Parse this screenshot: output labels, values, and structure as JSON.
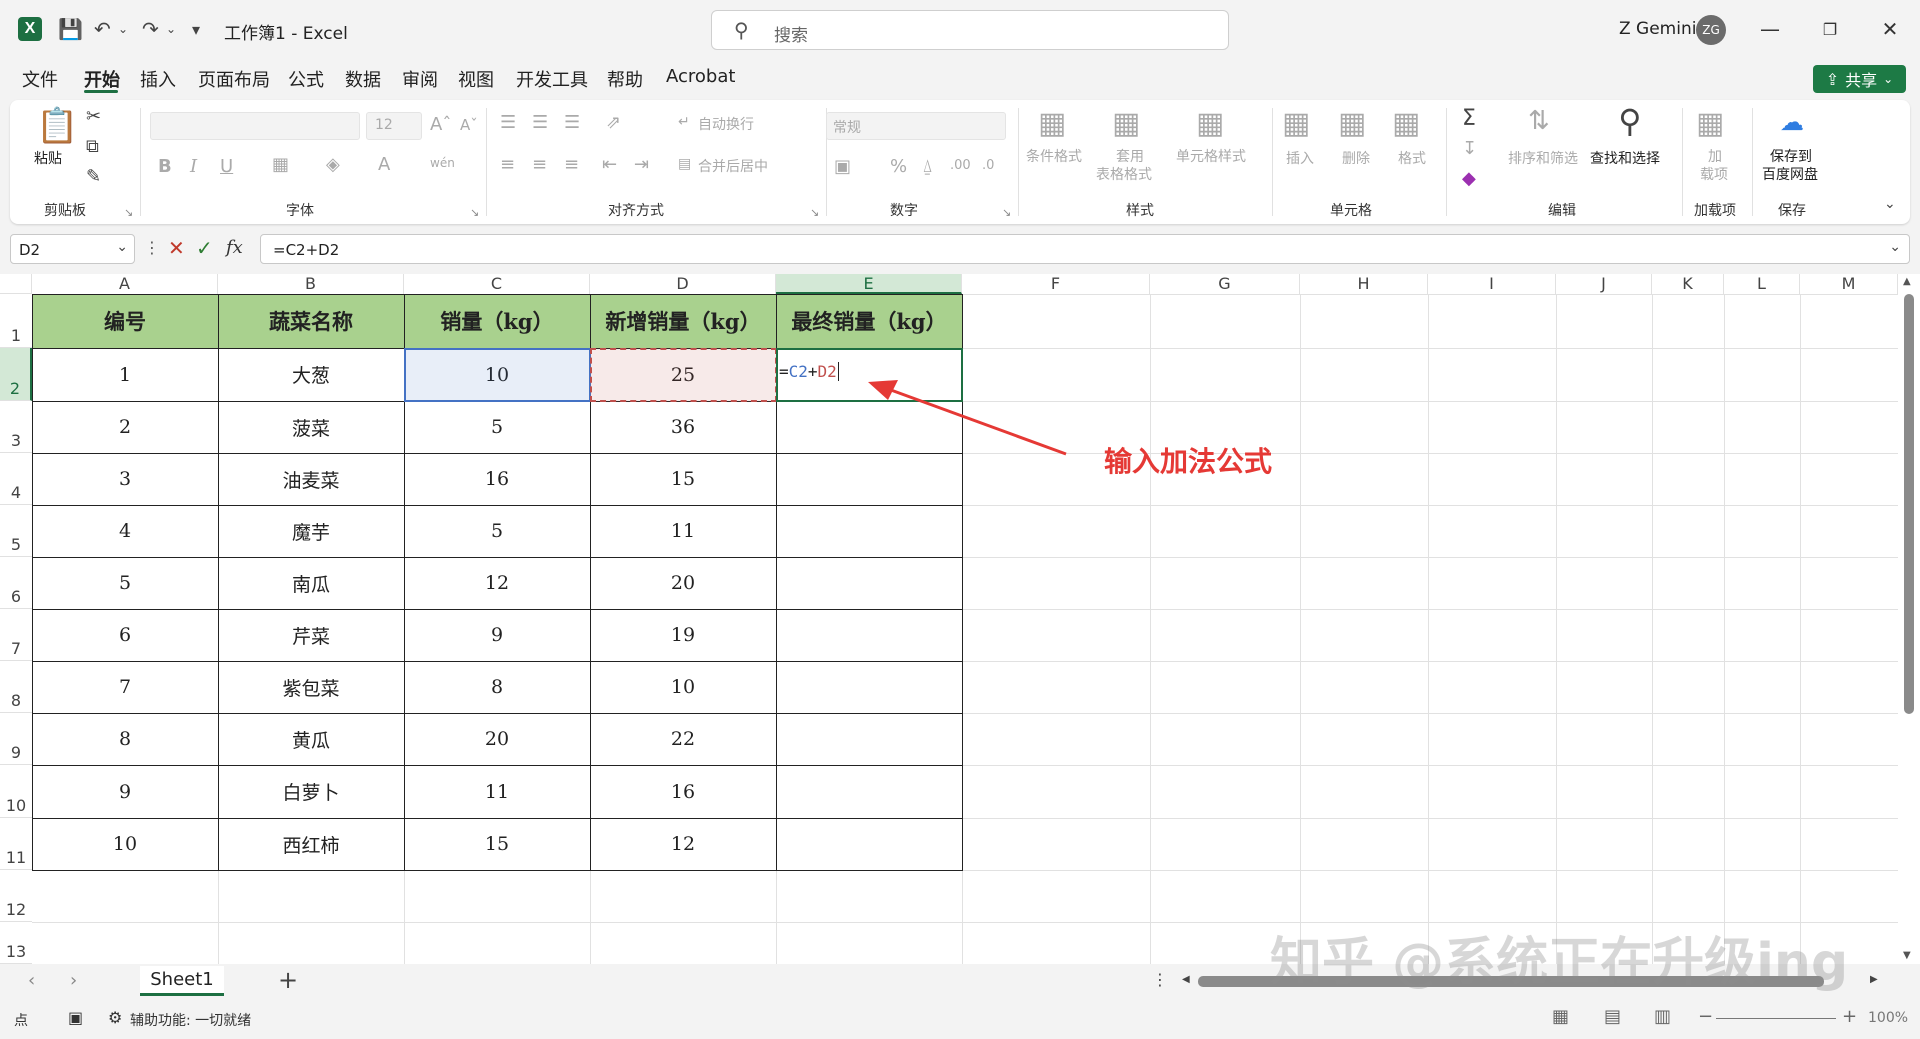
{
  "titlebar": {
    "doc_title": "工作簿1  -  Excel",
    "search_placeholder": "搜索",
    "user_name": "Z Gemini",
    "avatar_initials": "ZG"
  },
  "menu": {
    "items": [
      "文件",
      "开始",
      "插入",
      "页面布局",
      "公式",
      "数据",
      "审阅",
      "视图",
      "开发工具",
      "帮助",
      "Acrobat"
    ],
    "active": "开始",
    "share_label": "共享"
  },
  "ribbon": {
    "groups": [
      "剪贴板",
      "字体",
      "对齐方式",
      "数字",
      "样式",
      "单元格",
      "编辑",
      "加载项",
      "保存"
    ],
    "paste_label": "粘贴",
    "font_size": "12",
    "wrap_text": "自动换行",
    "merge_center": "合并后居中",
    "number_format": "常规",
    "conditional_format": "条件格式",
    "table_format_1": "套用",
    "table_format_2": "表格格式",
    "cell_styles": "单元格样式",
    "insert": "插入",
    "delete": "删除",
    "format": "格式",
    "sort_filter": "排序和筛选",
    "find_select": "查找和选择",
    "addins_1": "加",
    "addins_2": "载项",
    "save_baidu_1": "保存到",
    "save_baidu_2": "百度网盘"
  },
  "formula_bar": {
    "name_box": "D2",
    "formula": "=C2+D2"
  },
  "columns": [
    "A",
    "B",
    "C",
    "D",
    "E",
    "F",
    "G",
    "H",
    "I",
    "J",
    "K",
    "L",
    "M"
  ],
  "rows": [
    "1",
    "2",
    "3",
    "4",
    "5",
    "6",
    "7",
    "8",
    "9",
    "10",
    "11",
    "12",
    "13"
  ],
  "table": {
    "headers": [
      "编号",
      "蔬菜名称",
      "销量（kg）",
      "新增销量（kg）",
      "最终销量（kg）"
    ],
    "rows": [
      [
        "1",
        "大葱",
        "10",
        "25",
        ""
      ],
      [
        "2",
        "菠菜",
        "5",
        "36",
        ""
      ],
      [
        "3",
        "油麦菜",
        "16",
        "15",
        ""
      ],
      [
        "4",
        "魔芋",
        "5",
        "11",
        ""
      ],
      [
        "5",
        "南瓜",
        "12",
        "20",
        ""
      ],
      [
        "6",
        "芹菜",
        "9",
        "19",
        ""
      ],
      [
        "7",
        "紫包菜",
        "8",
        "10",
        ""
      ],
      [
        "8",
        "黄瓜",
        "20",
        "22",
        ""
      ],
      [
        "9",
        "白萝卜",
        "11",
        "16",
        ""
      ],
      [
        "10",
        "西红柿",
        "15",
        "12",
        ""
      ]
    ]
  },
  "edit_cell": {
    "eq": "=",
    "ref1": "C2",
    "plus": "+",
    "ref2": "D2"
  },
  "annotation": "输入加法公式",
  "sheet_tab": "Sheet1",
  "status": {
    "mode": "点",
    "accessibility": "辅助功能: 一切就绪",
    "zoom": "100%"
  },
  "watermark": "知乎 @系统正在升级ing",
  "colors": {
    "header_fill": "#a9d18e",
    "accent": "#1d6f42",
    "ref1": "#4472c4",
    "ref2": "#c0504d",
    "annotation": "#e53935"
  }
}
